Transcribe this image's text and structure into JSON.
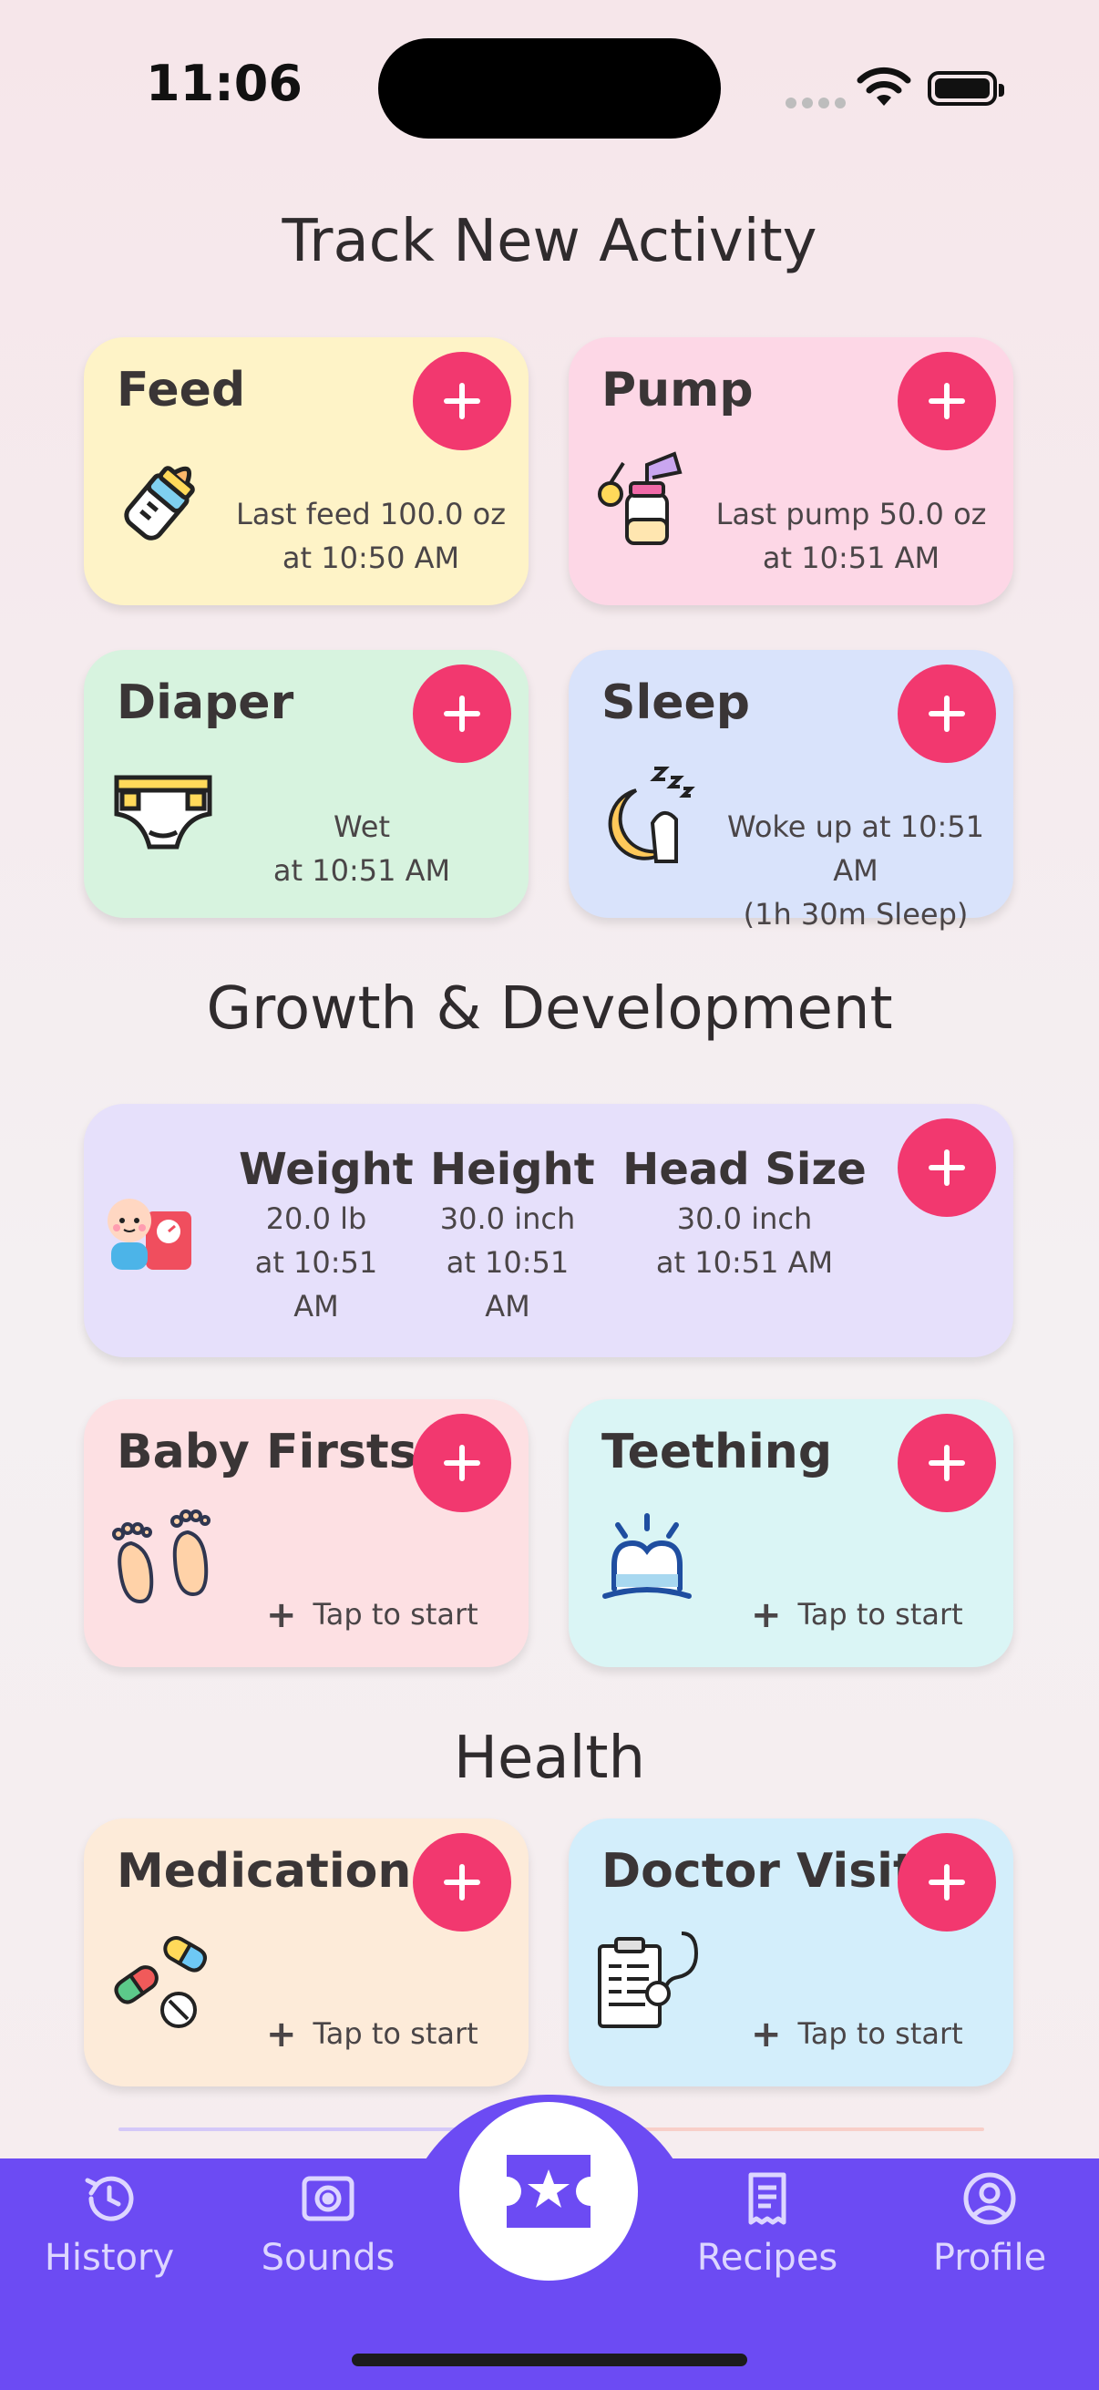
{
  "status": {
    "time": "11:06"
  },
  "sections": {
    "track": "Track New Activity",
    "growth": "Growth & Development",
    "health": "Health"
  },
  "cards": {
    "feed": {
      "title": "Feed",
      "line1": "Last feed 100.0 oz",
      "line2": "at 10:50 AM"
    },
    "pump": {
      "title": "Pump",
      "line1": "Last pump 50.0 oz",
      "line2": "at 10:51 AM"
    },
    "diaper": {
      "title": "Diaper",
      "line1": "Wet",
      "line2": "at 10:51 AM"
    },
    "sleep": {
      "title": "Sleep",
      "line1": "Woke up at 10:51 AM",
      "line2": "(1h 30m Sleep)"
    },
    "baby_firsts": {
      "title": "Baby Firsts",
      "tap": "Tap to start"
    },
    "teething": {
      "title": "Teething",
      "tap": "Tap to start"
    },
    "medication": {
      "title": "Medication",
      "tap": "Tap to start"
    },
    "doctor_visit": {
      "title": "Doctor Visit",
      "tap": "Tap to start"
    }
  },
  "growth": {
    "weight": {
      "label": "Weight",
      "value": "20.0 lb",
      "time": "at 10:51 AM"
    },
    "height": {
      "label": "Height",
      "value": "30.0 inch",
      "time": "at 10:51 AM"
    },
    "head": {
      "label": "Head Size",
      "value": "30.0 inch",
      "time": "at 10:51 AM"
    }
  },
  "nav": {
    "history": "History",
    "sounds": "Sounds",
    "recipes": "Recipes",
    "profile": "Profile"
  },
  "colors": {
    "accent": "#f2386f",
    "nav": "#6c4bf3",
    "feed_bg": "#fef3c7",
    "pump_bg": "#fdd7e6",
    "diaper_bg": "#d7f3df",
    "sleep_bg": "#d9e3fb",
    "growth_bg": "#e6e0fb",
    "firsts_bg": "#fde0e3",
    "teething_bg": "#daf5f5",
    "medication_bg": "#fdebd9",
    "doctor_bg": "#d3eefb"
  },
  "icons": {
    "feed": "baby-bottle-icon",
    "pump": "breast-pump-icon",
    "diaper": "diaper-icon",
    "sleep": "moon-sleep-icon",
    "growth": "baby-scale-icon",
    "firsts": "baby-feet-icon",
    "teething": "tooth-icon",
    "medication": "pills-icon",
    "doctor": "clipboard-stethoscope-icon",
    "center": "ticket-star-icon"
  }
}
